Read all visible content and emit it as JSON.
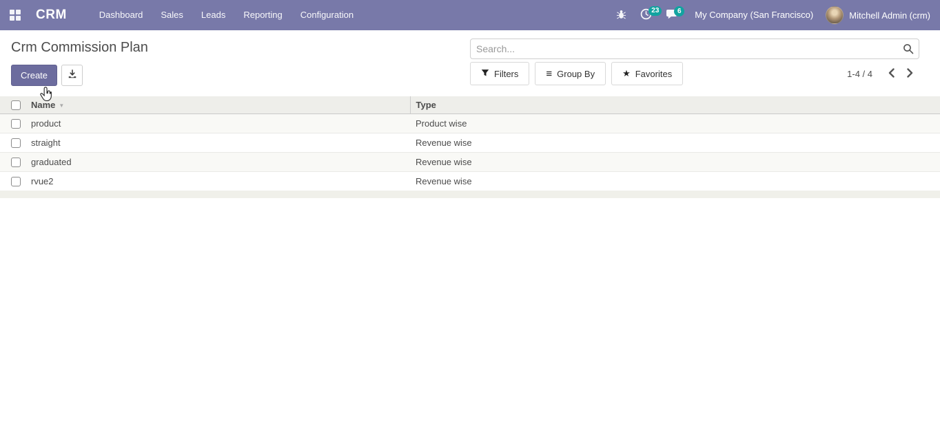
{
  "navbar": {
    "brand": "CRM",
    "menu": [
      "Dashboard",
      "Sales",
      "Leads",
      "Reporting",
      "Configuration"
    ],
    "activities_count": "23",
    "messages_count": "6",
    "company": "My Company (San Francisco)",
    "user": "Mitchell Admin (crm)"
  },
  "control_panel": {
    "title": "Crm Commission Plan",
    "create_label": "Create",
    "search": {
      "placeholder": "Search...",
      "value": ""
    },
    "filters_label": "Filters",
    "group_by_label": "Group By",
    "favorites_label": "Favorites",
    "pager": "1-4 / 4"
  },
  "table": {
    "headers": {
      "name": "Name",
      "type": "Type"
    },
    "rows": [
      {
        "name": "product",
        "type": "Product wise"
      },
      {
        "name": "straight",
        "type": "Revenue wise"
      },
      {
        "name": "graduated",
        "type": "Revenue wise"
      },
      {
        "name": "rvue2",
        "type": "Revenue wise"
      }
    ]
  },
  "icons": {
    "star": "★",
    "group_by": "≡",
    "sort_caret": "▼"
  },
  "colors": {
    "navbar_bg": "#7879a9",
    "badge_teal": "#12a3a0",
    "primary_button": "#6c6c9e",
    "header_bg": "#eeeeea",
    "row_stripe": "#f9f9f6"
  }
}
